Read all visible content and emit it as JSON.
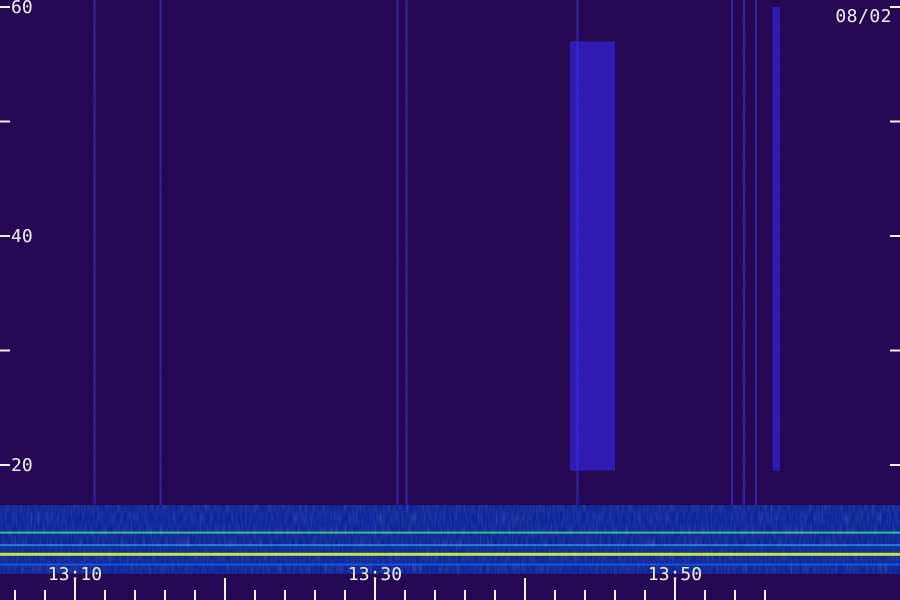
{
  "chart_data": {
    "type": "heatmap",
    "date_label": "08/02",
    "y_axis": {
      "range": [
        10,
        60
      ],
      "ticks": [
        20,
        30,
        40,
        50,
        60
      ],
      "tick_labels": [
        "20",
        "",
        "40",
        "",
        "60"
      ]
    },
    "x_axis": {
      "start": "13:05",
      "end": "13:57",
      "major_labels": [
        "13:10",
        "13:30",
        "13:50"
      ],
      "minor_ticks_minutes": [
        2,
        5
      ]
    },
    "background_color": "#2d0a66",
    "strong_band": {
      "y_range": [
        10.5,
        16.5
      ],
      "colors": [
        "#0a2aa8",
        "#1a64ff",
        "#18d9ff",
        "#48ff88",
        "#d6ff2e"
      ]
    },
    "bright_bands": [
      {
        "time_range": [
          "13:43",
          "13:46"
        ],
        "y_range": [
          19.5,
          57
        ],
        "color": "#3c2cff"
      },
      {
        "time_range": [
          "13:56.5",
          "13:57"
        ],
        "y_range": [
          19.5,
          60
        ],
        "color": "#3c2cff"
      }
    ],
    "vertical_streaks_minutes": [
      11.3,
      15.7,
      31.5,
      32.1,
      43.5,
      53.8,
      54.6,
      55.4
    ],
    "colorscale_hint": [
      "#1f0636",
      "#2d0a66",
      "#3c2cff",
      "#1a64ff",
      "#18d9ff",
      "#48ff88",
      "#d6ff2e"
    ]
  }
}
